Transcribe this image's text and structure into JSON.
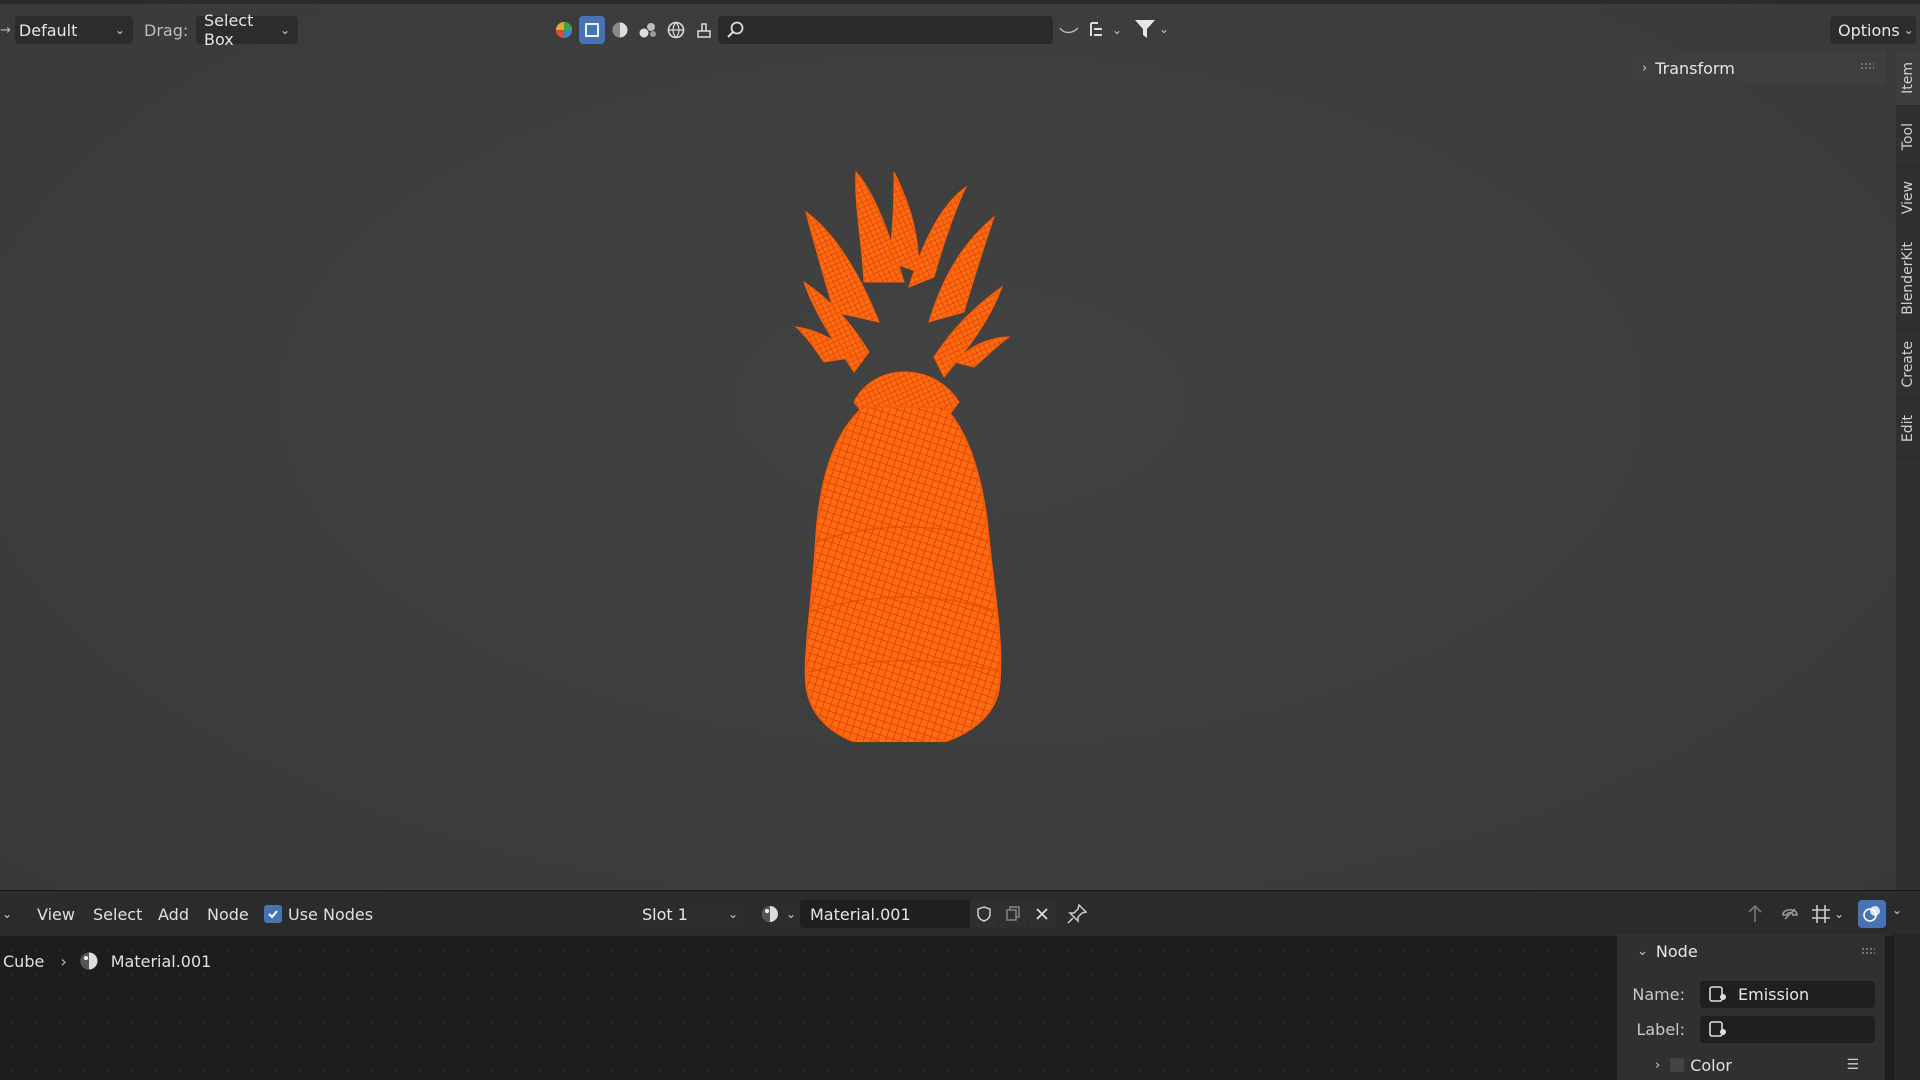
{
  "viewport_header": {
    "mode_select": "Default",
    "drag_label": "Drag:",
    "drag_select": "Select Box",
    "options_label": "Options",
    "search_placeholder": ""
  },
  "sidebar_panel": {
    "transform_label": "Transform"
  },
  "side_tabs": [
    "Item",
    "Tool",
    "View",
    "BlenderKit",
    "Create",
    "Edit"
  ],
  "model": {
    "name": "pineapple-wireframe",
    "color": "#ff5a00"
  },
  "node_editor": {
    "menu": [
      "View",
      "Select",
      "Add",
      "Node"
    ],
    "use_nodes_label": "Use Nodes",
    "use_nodes_checked": true,
    "slot_select": "Slot 1",
    "material_name": "Material.001",
    "breadcrumb": {
      "object": "Cube",
      "material": "Material.001"
    }
  },
  "node_panel": {
    "header": "Node",
    "name_label": "Name:",
    "name_value": "Emission",
    "label_label": "Label:",
    "label_value": "",
    "color_label": "Color"
  },
  "colors": {
    "accent": "#4772b3",
    "wire": "#ff5a00",
    "viewport_bg": "#3d3d3d",
    "editor_bg": "#1d1d1d"
  }
}
